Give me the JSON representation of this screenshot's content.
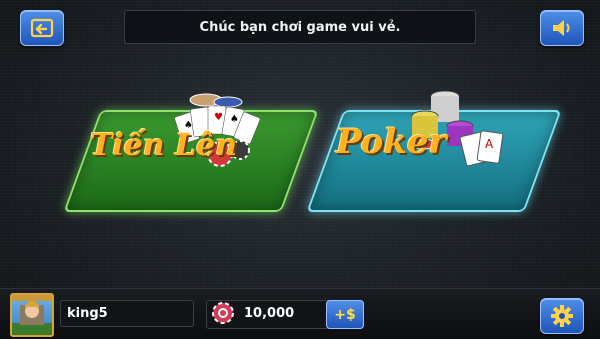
{
  "top_bar": {
    "back_icon": "back-arrow-icon",
    "notice_text": "Chúc bạn chơi game vui vẻ.",
    "sound_icon": "speaker-icon"
  },
  "games": [
    {
      "label_line1": "Tiến",
      "label_line2": "Lên",
      "color": "#2f8a27"
    },
    {
      "label": "Poker",
      "color": "#1f8fa2"
    }
  ],
  "player": {
    "avatar_icon": "player-avatar",
    "name": "king5",
    "chips": "10,000",
    "add_money_label": "+$"
  },
  "settings_icon": "gear-icon",
  "colors": {
    "accent_blue": "#2f6fd0",
    "title_orange": "#ffb11f"
  }
}
